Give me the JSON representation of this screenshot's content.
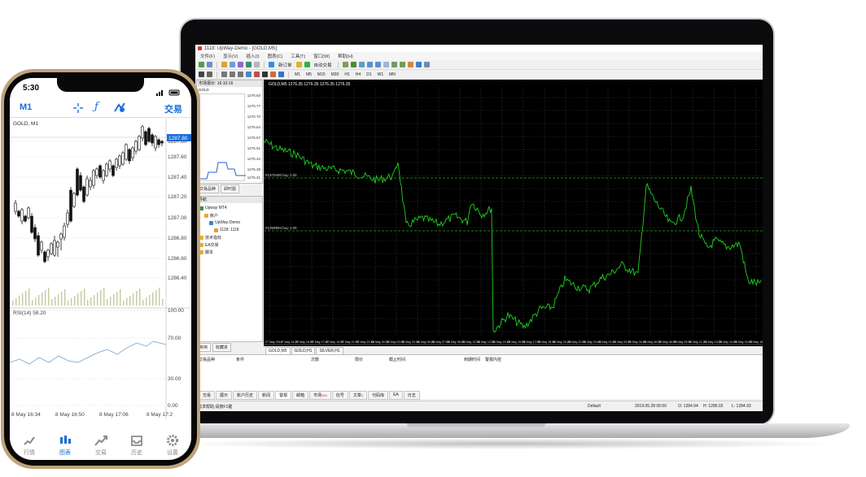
{
  "desktop": {
    "window_title": "1118: UpWay-Demo - [GOLD,M5]",
    "menu": [
      "文件(F)",
      "显示(V)",
      "插入(I)",
      "图表(C)",
      "工具(T)",
      "窗口(W)",
      "帮助(H)"
    ],
    "toolbar": {
      "new_order_label": "新订单",
      "auto_trade_label": "自动交易",
      "timeframes": [
        "M1",
        "M5",
        "M15",
        "M30",
        "H1",
        "H4",
        "D1",
        "W1",
        "MN"
      ]
    },
    "market_watch": {
      "title": "市场报价: 16:10:16",
      "symbol": "GOLD",
      "prices": [
        "1276.83",
        "1276.77",
        "1276.70",
        "1276.64",
        "1276.57",
        "1276.51",
        "1276.44",
        "1276.38",
        "1276.31"
      ],
      "tabs": [
        "交易品种",
        "即时图"
      ]
    },
    "navigator": {
      "title": "导航",
      "items": [
        "Upway MT4",
        "账户",
        "UpWay-Demo",
        "1118: 1118",
        "技术指标",
        "EA交易",
        "脚本"
      ],
      "tabs": [
        "常用",
        "收藏夹"
      ]
    },
    "chart": {
      "header": "GOLD,M5  1276.35 1276.35 1276.35 1276.35",
      "order_line_1": "#1370400 buy 1.00",
      "order_line_2": "#1359994 buy 1.00",
      "x_labels": [
        "27 May 2019",
        "27 May 14:25",
        "27 May 16:05",
        "27 May 17:45",
        "27 May 19:25",
        "27 May 21:05",
        "27 May 22:45",
        "28 May 00:25",
        "28 May 02:05",
        "28 May 03:45",
        "28 May 05:25",
        "28 May 07:05",
        "28 May 08:45",
        "28 May 10:25",
        "28 May 12:05",
        "28 May 13:45",
        "28 May 15:25",
        "28 May 17:05",
        "28 May 18:45",
        "28 May 20:25",
        "28 May 22:05",
        "28 May 23:45",
        "29 May 01:25",
        "29 May 03:05",
        "29 May 04:45",
        "29 May 06:25",
        "29 May 08:05",
        "29 May 09:45",
        "29 May 11:25",
        "29 May 13:05",
        "29 May 14:45",
        "29 May 16:25",
        "29 May 18:05"
      ],
      "tabs": [
        "GOLD,M5",
        "GOLD,H1",
        "SILVER,H1"
      ],
      "line_color": "#1fd11f",
      "background": "#000000"
    },
    "terminal": {
      "columns": [
        "交易品种",
        "条件",
        "次数",
        "限价",
        "截止时间",
        "到期时间",
        "警报内容"
      ],
      "tabs": [
        "交易",
        "展示",
        "账户历史",
        "新闻",
        "警报",
        "邮箱",
        "市场",
        "信号",
        "文章",
        "代码库",
        "EA",
        "日志"
      ],
      "badges": {
        "市场": "100",
        "文章": "2"
      }
    },
    "status": {
      "help": "需求帮助,请按F1键",
      "profile": "Default",
      "datetime": "2019.05.28 06:50",
      "open": "O: 1284.94",
      "high": "H: 1285.02",
      "low": "L: 1284.93",
      "close": "C: 1284.96"
    }
  },
  "mobile": {
    "time": "5:30",
    "timeframe": "M1",
    "trade_label": "交易",
    "symbol_label": "GOLD, M1",
    "price_labels": [
      "1287.80",
      "1287.60",
      "1287.40",
      "1287.20",
      "1287.00",
      "1286.80",
      "1286.60",
      "1286.40"
    ],
    "current_price": "1287.80",
    "rsi_label": "RSI(14) 58.20",
    "rsi_levels": [
      "100.00",
      "70.00",
      "30.00",
      "0.00"
    ],
    "time_labels": [
      "8 May 16:34",
      "8 May 16:50",
      "8 May 17:06",
      "8 May 17:2"
    ],
    "nav": [
      "行情",
      "图表",
      "交易",
      "历史",
      "设置"
    ],
    "accent_color": "#1b6dd6"
  }
}
